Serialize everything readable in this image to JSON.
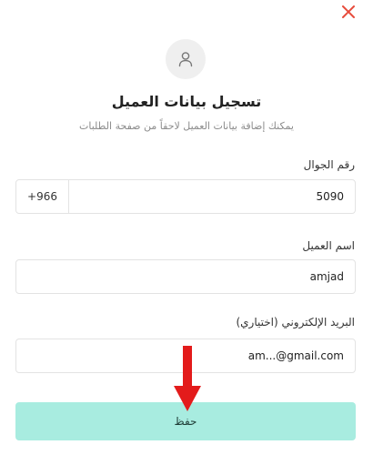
{
  "dialog": {
    "title": "تسجيل بيانات العميل",
    "subtitle": "يمكنك إضافة بيانات العميل لاحقاً من صفحة الطلبات",
    "icons": {
      "close": "close-icon",
      "avatar": "user-icon",
      "annotation": "red-down-arrow-icon"
    },
    "colors": {
      "close": "#e74c3c",
      "button_bg": "#a8ece0",
      "arrow": "#e31b1b"
    }
  },
  "phone": {
    "label": "رقم الجوال",
    "country_code": "+966",
    "value": "5090"
  },
  "name": {
    "label": "اسم العميل",
    "value": "amjad"
  },
  "email": {
    "label": "البريد الإلكتروني (اختياري)",
    "value": "am...@gmail.com"
  },
  "actions": {
    "save_label": "حفظ"
  }
}
